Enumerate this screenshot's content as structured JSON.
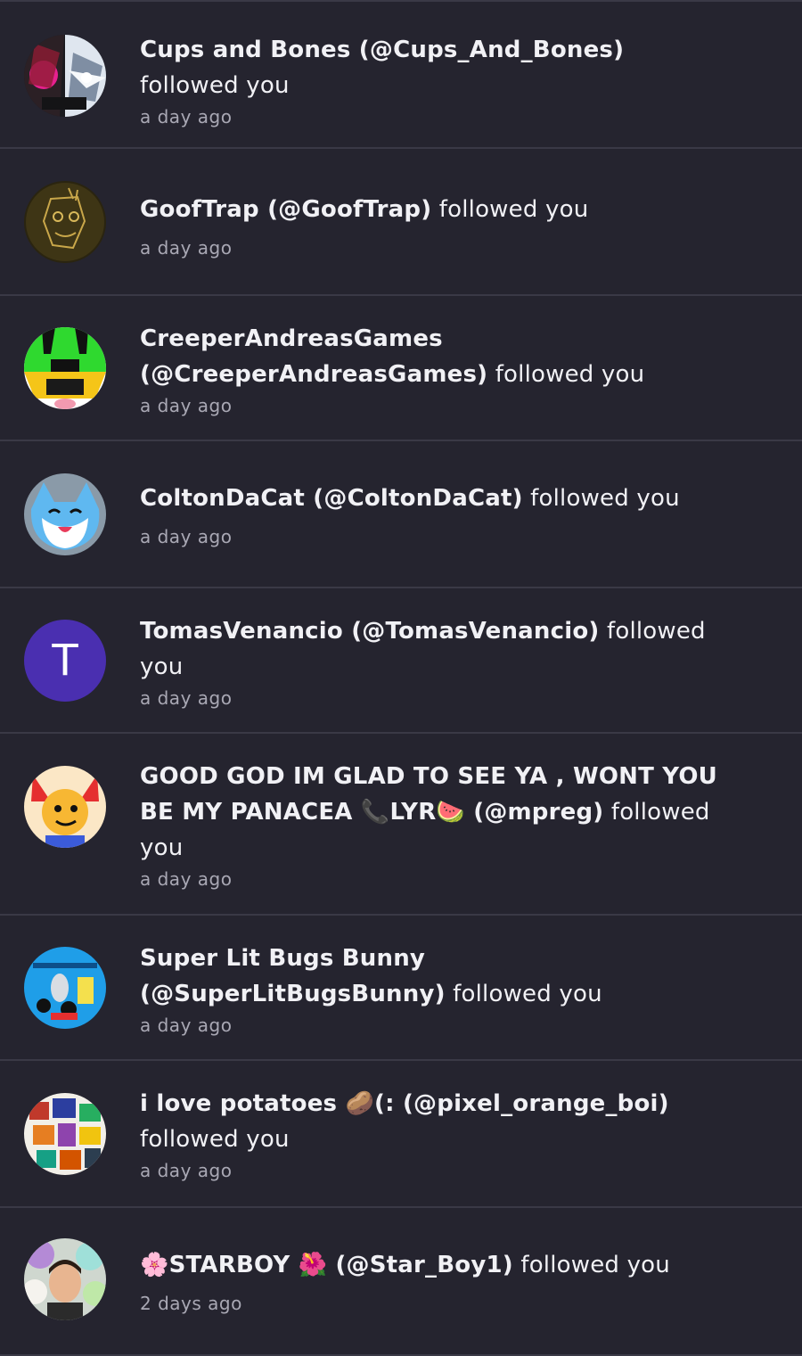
{
  "notifications": [
    {
      "name": "Cups and Bones (@Cups_And_Bones)",
      "action": "followed you",
      "time": "a day ago",
      "avatar": "dark-monochrome-character-art"
    },
    {
      "name": "GoofTrap (@GoofTrap)",
      "action": "followed you",
      "time": "a day ago",
      "avatar": "dark-gold-sketch-art"
    },
    {
      "name": "CreeperAndreasGames (@CreeperAndreasGames)",
      "action": "followed you",
      "time": "a day ago",
      "avatar": "green-helmet-character-art"
    },
    {
      "name": "ColtonDaCat (@ColtonDaCat)",
      "action": "followed you",
      "time": "a day ago",
      "avatar": "blue-cat-art"
    },
    {
      "name": "TomasVenancio (@TomasVenancio)",
      "action": "followed you",
      "time": "a day ago",
      "avatar": "letter-avatar",
      "avatar_letter": "T",
      "avatar_color": "#4a2fb0"
    },
    {
      "name": "GOOD GOD IM GLAD TO SEE YA , WONT YOU BE MY PANACEA 📞LYR🍉 (@mpreg)",
      "action": "followed you",
      "time": "a day ago",
      "avatar": "red-horned-character-art"
    },
    {
      "name": "Super Lit Bugs Bunny (@SuperLitBugsBunny)",
      "action": "followed you",
      "time": "a day ago",
      "avatar": "cartoon-collage-art"
    },
    {
      "name": "i love potatoes 🥔(: (@pixel_orange_boi)",
      "action": "followed you",
      "time": "a day ago",
      "avatar": "collage-art"
    },
    {
      "name": "🌸STARBOY 🌺 (@Star_Boy1)",
      "action": "followed you",
      "time": "2 days ago",
      "avatar": "photo-with-plushies"
    }
  ],
  "colors": {
    "background": "#25242f",
    "divider": "#3a3946",
    "text": "#f1f1f5",
    "muted": "#a9a8b4"
  }
}
